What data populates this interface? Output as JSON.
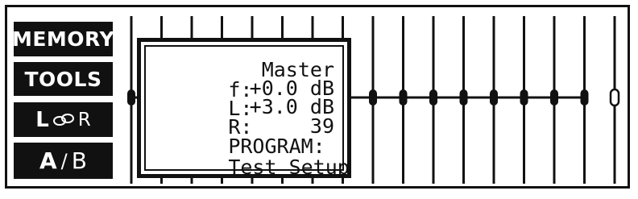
{
  "side_buttons": {
    "memory": "MEMORY",
    "tools": "TOOLS",
    "link": {
      "left": "L",
      "icon": "link-icon",
      "right": "R"
    },
    "ab": {
      "a": "A",
      "slash": "/",
      "b": "B"
    }
  },
  "popup": {
    "function_label": "f:",
    "function_value": "Master",
    "left_label": "L:",
    "left_value": "+0.0 dB",
    "right_label": "R:",
    "right_value": "+3.0 dB",
    "program_label": "PROGRAM:",
    "program_value": "39",
    "status_text": "Test Setup"
  },
  "faders": {
    "count": 17,
    "selected_index": 16,
    "color": "#111111"
  }
}
